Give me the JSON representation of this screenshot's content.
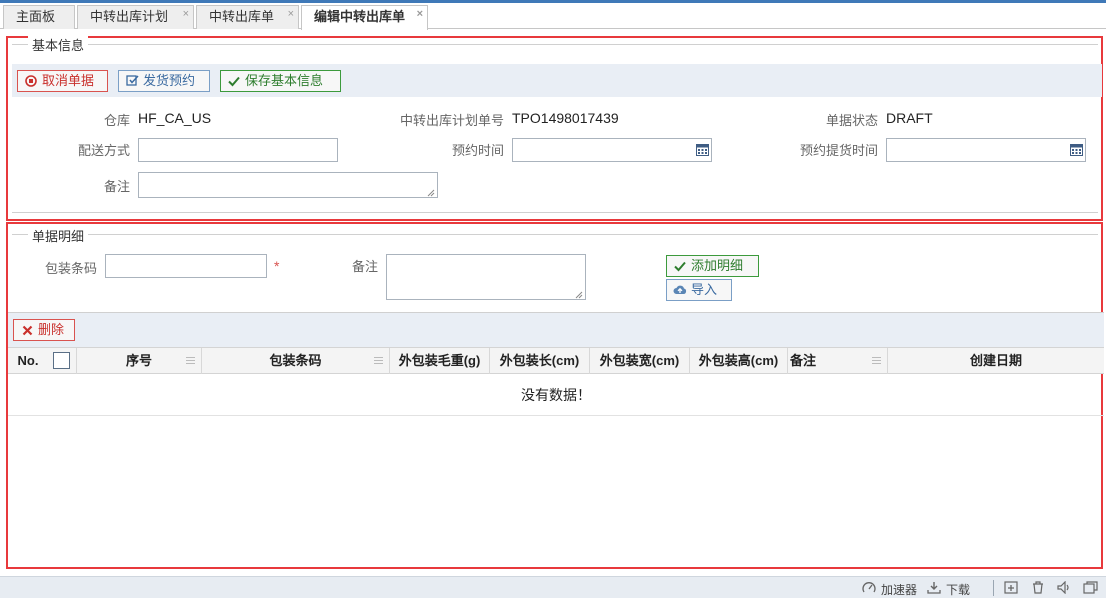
{
  "tabs": [
    {
      "label": "主面板",
      "closable": false,
      "active": false
    },
    {
      "label": "中转出库计划",
      "closable": true,
      "active": false
    },
    {
      "label": "中转出库单",
      "closable": true,
      "active": false
    },
    {
      "label": "编辑中转出库单",
      "closable": true,
      "active": true
    }
  ],
  "close_glyph": "×",
  "basic": {
    "legend": "基本信息",
    "buttons": {
      "cancel": "取消单据",
      "reserve": "发货预约",
      "save": "保存基本信息"
    },
    "fields": {
      "warehouse_label": "仓库",
      "warehouse_value": "HF_CA_US",
      "plan_no_label": "中转出库计划单号",
      "plan_no_value": "TPO1498017439",
      "status_label": "单据状态",
      "status_value": "DRAFT",
      "delivery_label": "配送方式",
      "delivery_value": "",
      "reserve_time_label": "预约时间",
      "reserve_time_value": "",
      "pickup_time_label": "预约提货时间",
      "pickup_time_value": "",
      "remark_label": "备注",
      "remark_value": ""
    }
  },
  "detail": {
    "legend": "单据明细",
    "barcode_label": "包装条码",
    "barcode_value": "",
    "required_mark": "*",
    "remark_label": "备注",
    "remark_value": "",
    "add_button": "添加明细",
    "import_button": "导入",
    "delete_button": "删除",
    "columns": [
      "No.",
      "序号",
      "包装条码",
      "外包装毛重(g)",
      "外包装长(cm)",
      "外包装宽(cm)",
      "外包装高(cm)",
      "备注",
      "创建日期"
    ],
    "empty_text": "没有数据！"
  },
  "statusbar": {
    "accelerator": "加速器",
    "download": "下载"
  },
  "colors": {
    "accent": "#3f79b8",
    "highlight": "#e8393c",
    "danger": "#c9302c",
    "success": "#2e7d2e"
  }
}
